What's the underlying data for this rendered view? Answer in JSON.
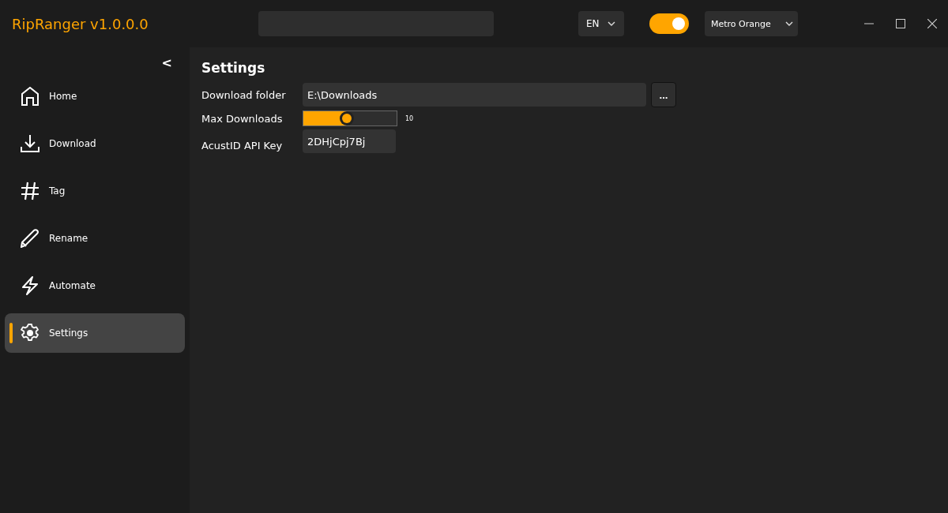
{
  "window": {
    "title": "RipRanger v1.0.0.0"
  },
  "toolbar": {
    "language": {
      "value": "EN"
    },
    "theme_toggle": {
      "on": true
    },
    "theme": {
      "value": "Metro Orange"
    }
  },
  "sidebar": {
    "collapse": "<",
    "items": [
      {
        "label": "Home",
        "kind": "home",
        "selected": false
      },
      {
        "label": "Download",
        "kind": "download",
        "selected": false
      },
      {
        "label": "Tag",
        "kind": "tag",
        "selected": false
      },
      {
        "label": "Rename",
        "kind": "rename",
        "selected": false
      },
      {
        "label": "Automate",
        "kind": "automate",
        "selected": false
      },
      {
        "label": "Settings",
        "kind": "settings",
        "selected": true
      }
    ]
  },
  "settings": {
    "title": "Settings",
    "download_folder": {
      "label": "Download folder",
      "value": "E:\\Downloads",
      "browse": "..."
    },
    "max_downloads": {
      "label": "Max Downloads",
      "level": 0.47,
      "reading": "10"
    },
    "api_key": {
      "label": "AcustID API Key",
      "value": "2DHjCpj7Bj"
    }
  }
}
